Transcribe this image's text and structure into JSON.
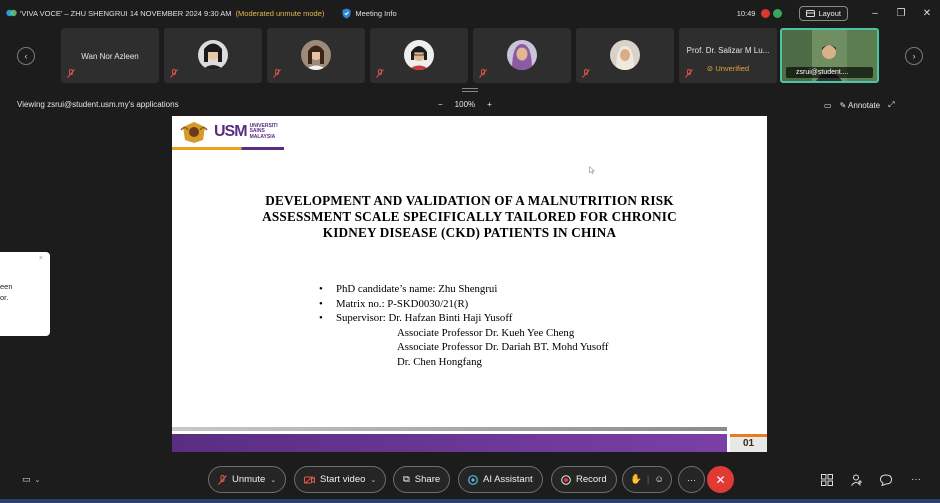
{
  "titlebar": {
    "title": "'VIVA VOCE' – ZHU SHENGRUI 14 NOVEMBER 2024 9:30 AM",
    "moderated": "(Moderated unmute mode)",
    "meeting_info": "Meeting Info",
    "time": "10:49",
    "layout_label": "Layout",
    "colors": {
      "accent_warning": "#e5b94f",
      "record_dot": "#d9392e",
      "live_dot": "#3aa55d"
    }
  },
  "participants": [
    {
      "name": "Wan Nor Azleen",
      "has_video": false
    },
    {
      "name": "",
      "has_video": true
    },
    {
      "name": "",
      "has_video": true
    },
    {
      "name": "",
      "has_video": true
    },
    {
      "name": "",
      "has_video": true
    },
    {
      "name": "",
      "has_video": true
    },
    {
      "name": "Prof. Dr. Salizar M Lu...",
      "status": "Unverified",
      "has_video": false
    },
    {
      "name": "zsrui@student....",
      "self": true,
      "has_video": true
    }
  ],
  "share_bar": {
    "viewing": "Viewing zsrui@student.usm.my's applications",
    "zoom_minus": "−",
    "zoom": "100%",
    "zoom_plus": "+",
    "annotate": "Annotate"
  },
  "slide": {
    "logo_word": "USM",
    "logo_sub1": "UNIVERSITI",
    "logo_sub2": "SAINS",
    "logo_sub3": "MALAYSIA",
    "title_line1": "DEVELOPMENT AND VALIDATION OF A MALNUTRITION RISK",
    "title_line2": "ASSESSMENT SCALE SPECIFICALLY TAILORED FOR CHRONIC",
    "title_line3": "KIDNEY DISEASE (CKD) PATIENTS IN CHINA",
    "bullet_char": "•",
    "bullets": [
      "PhD candidate’s name: Zhu Shengrui",
      "Matrix no.: P-SKD0030/21(R)",
      "Supervisor: Dr. Hafzan Binti Haji Yusoff"
    ],
    "supervisors_cont": [
      "Associate Professor Dr. Kueh Yee Cheng",
      "Associate Professor Dr. Dariah BT. Mohd Yusoff",
      "Dr. Chen Hongfang"
    ],
    "page_number": "01"
  },
  "toast": {
    "line1": "een",
    "line2": "or.",
    "close": "×"
  },
  "controls": {
    "unmute": "Unmute",
    "start_video": "Start video",
    "share": "Share",
    "ai_assistant": "AI Assistant",
    "record": "Record",
    "more": "···",
    "end": "✕"
  }
}
